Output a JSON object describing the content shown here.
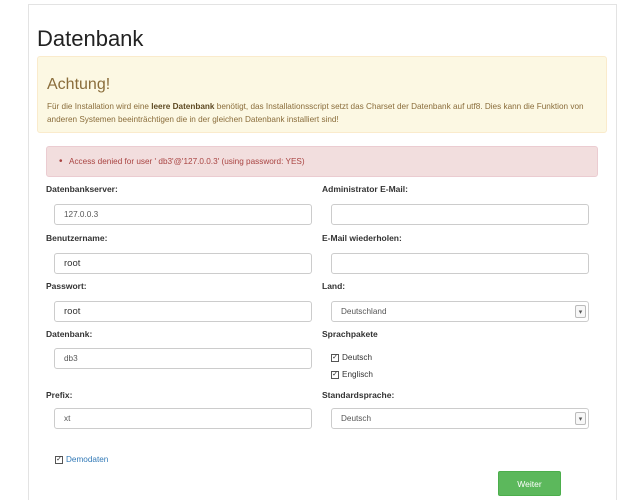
{
  "page_title": "Datenbank",
  "warning": {
    "heading": "Achtung!",
    "text_before": "Für die Installation wird eine ",
    "text_bold": "leere Datenbank",
    "text_after": " benötigt, das Installationsscript setzt das Charset der Datenbank auf utf8. Dies kann die Funktion von anderen Systemen beeinträchtigen die in der gleichen Datenbank installiert sind!"
  },
  "error": {
    "message": "Access denied for user ' db3'@'127.0.0.3' (using password: YES)"
  },
  "form": {
    "db_server": {
      "label": "Datenbankserver:",
      "value": "127.0.0.3"
    },
    "username": {
      "label": "Benutzername:",
      "value": "root"
    },
    "password": {
      "label": "Passwort:",
      "value": "root"
    },
    "database": {
      "label": "Datenbank:",
      "value": "db3"
    },
    "prefix": {
      "label": "Prefix:",
      "value": "xt"
    },
    "admin_email": {
      "label": "Administrator E-Mail:",
      "value": ""
    },
    "email_repeat": {
      "label": "E-Mail wiederholen:",
      "value": ""
    },
    "country": {
      "label": "Land:",
      "value": "Deutschland"
    },
    "language_packs": {
      "label": "Sprachpakete",
      "items": [
        {
          "label": "Deutsch",
          "checked": true
        },
        {
          "label": "Englisch",
          "checked": true
        }
      ]
    },
    "default_language": {
      "label": "Standardsprache:",
      "value": "Deutsch"
    },
    "demo_data": {
      "label": "Demodaten",
      "checked": true
    },
    "submit_label": "Weiter"
  },
  "colors": {
    "warning_bg": "#fcf8e3",
    "error_bg": "#f2dede",
    "button_bg": "#5cb85c",
    "link": "#337ab7"
  }
}
